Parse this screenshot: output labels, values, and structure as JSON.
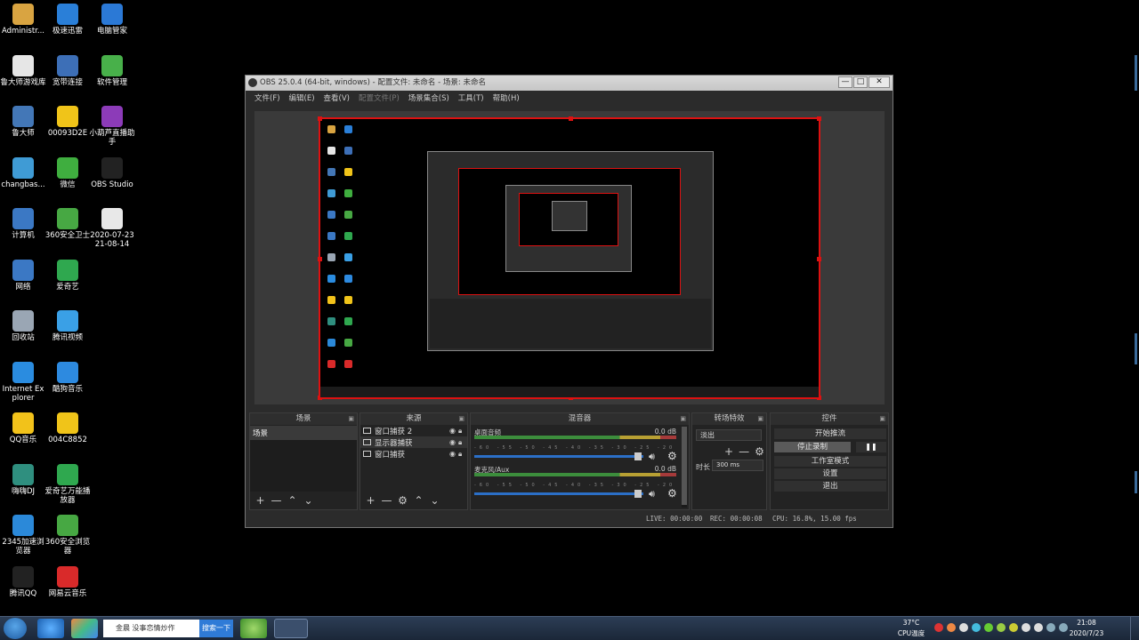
{
  "desktop": {
    "icons": [
      {
        "label": "Administr...",
        "icon": "folder-icon",
        "color": "#d9a441"
      },
      {
        "label": "极速迅雷",
        "icon": "thunder-icon",
        "color": "#2a7fd8"
      },
      {
        "label": "电脑管家",
        "icon": "shield-icon",
        "color": "#2b79d6"
      },
      {
        "label": "鲁大师游戏库",
        "icon": "gamepad-icon",
        "color": "#e6e6e6"
      },
      {
        "label": "宽带连接",
        "icon": "network-icon",
        "color": "#3d6fb7"
      },
      {
        "label": "软件管理",
        "icon": "software-icon",
        "color": "#48b04a"
      },
      {
        "label": "鲁大师",
        "icon": "ludashi-icon",
        "color": "#4377b7"
      },
      {
        "label": "00093D2E",
        "icon": "emoji-icon",
        "color": "#f0c419"
      },
      {
        "label": "小葫芦直播助手",
        "icon": "gourd-icon",
        "color": "#8c3bb8"
      },
      {
        "label": "changbas...",
        "icon": "archive-icon",
        "color": "#3f9bd5"
      },
      {
        "label": "微信",
        "icon": "wechat-icon",
        "color": "#3fae3f"
      },
      {
        "label": "OBS Studio",
        "icon": "obs-icon",
        "color": "#222222"
      },
      {
        "label": "计算机",
        "icon": "computer-icon",
        "color": "#3b78c4"
      },
      {
        "label": "360安全卫士",
        "icon": "guard-360-icon",
        "color": "#47a843"
      },
      {
        "label": "2020-07-23 21-08-14",
        "icon": "document-icon",
        "color": "#e8e8e8"
      },
      {
        "label": "网络",
        "icon": "globe-network-icon",
        "color": "#3b78c4"
      },
      {
        "label": "爱奇艺",
        "icon": "iqiyi-icon",
        "color": "#2fa84f"
      },
      {
        "label": "回收站",
        "icon": "recycle-bin-icon",
        "color": "#9aa6b4"
      },
      {
        "label": "腾讯视频",
        "icon": "tencent-video-icon",
        "color": "#3aa0e6"
      },
      {
        "label": "Internet Explorer",
        "icon": "ie-icon",
        "color": "#2a8ce0"
      },
      {
        "label": "酷狗音乐",
        "icon": "kugou-icon",
        "color": "#2d8ae0"
      },
      {
        "label": "QQ音乐",
        "icon": "qqmusic-icon",
        "color": "#f2c21a"
      },
      {
        "label": "004C8852",
        "icon": "emoji-icon",
        "color": "#f0c419"
      },
      {
        "label": "嗨嗨DJ",
        "icon": "dj-icon",
        "color": "#2f8f7f"
      },
      {
        "label": "爱奇艺万能播放器",
        "icon": "player-icon",
        "color": "#2fa84f"
      },
      {
        "label": "2345加速浏览器",
        "icon": "browser-2345-icon",
        "color": "#2b89d9"
      },
      {
        "label": "360安全浏览器",
        "icon": "browser-360-icon",
        "color": "#47a843"
      },
      {
        "label": "腾讯QQ",
        "icon": "qq-icon",
        "color": "#222222"
      },
      {
        "label": "网易云音乐",
        "icon": "netease-music-icon",
        "color": "#d92a2a"
      }
    ]
  },
  "obs": {
    "title": "OBS 25.0.4 (64-bit, windows) - 配置文件: 未命名 - 场景: 未命名",
    "window_buttons": {
      "minimize": "—",
      "maximize": "□",
      "close": "✕"
    },
    "menu": [
      "文件(F)",
      "编辑(E)",
      "查看(V)",
      "配置文件(P)",
      "场景集合(S)",
      "工具(T)",
      "帮助(H)"
    ],
    "docks": {
      "scenes": {
        "title": "场景",
        "items": [
          "场景"
        ]
      },
      "sources": {
        "title": "来源",
        "items": [
          "窗口捕获 2",
          "显示器捕获",
          "窗口捕获"
        ]
      },
      "mixer": {
        "title": "混音器",
        "channels": [
          {
            "name": "桌面音频",
            "db": "0.0 dB"
          },
          {
            "name": "麦克风/Aux",
            "db": "0.0 dB"
          }
        ],
        "scale": "-60 -55 -50 -45 -40 -35 -30 -25 -20 -15 -10 -5 0"
      },
      "transitions": {
        "title": "转场特效",
        "selected": "淡出",
        "duration_label": "时长",
        "duration": "300 ms"
      },
      "controls": {
        "title": "控件",
        "start_stream": "开始推流",
        "stop_record": "停止录制",
        "pause": "❚❚",
        "studio_mode": "工作室模式",
        "settings": "设置",
        "exit": "退出"
      }
    },
    "status": {
      "live": "LIVE: 00:00:00",
      "rec": "REC: 00:00:08",
      "cpu": "CPU: 16.8%, 15.00 fps"
    }
  },
  "taskbar": {
    "search_text": "金晨 没事恋情炒作",
    "search_button": "搜索一下",
    "temp": "37°C",
    "temp_label": "CPU温度",
    "time": "21:08",
    "date": "2020/7/23"
  },
  "colors": {
    "accent_red": "#dd1111",
    "obs_bg": "#2b2b2b",
    "taskbar": "#1b2738"
  }
}
